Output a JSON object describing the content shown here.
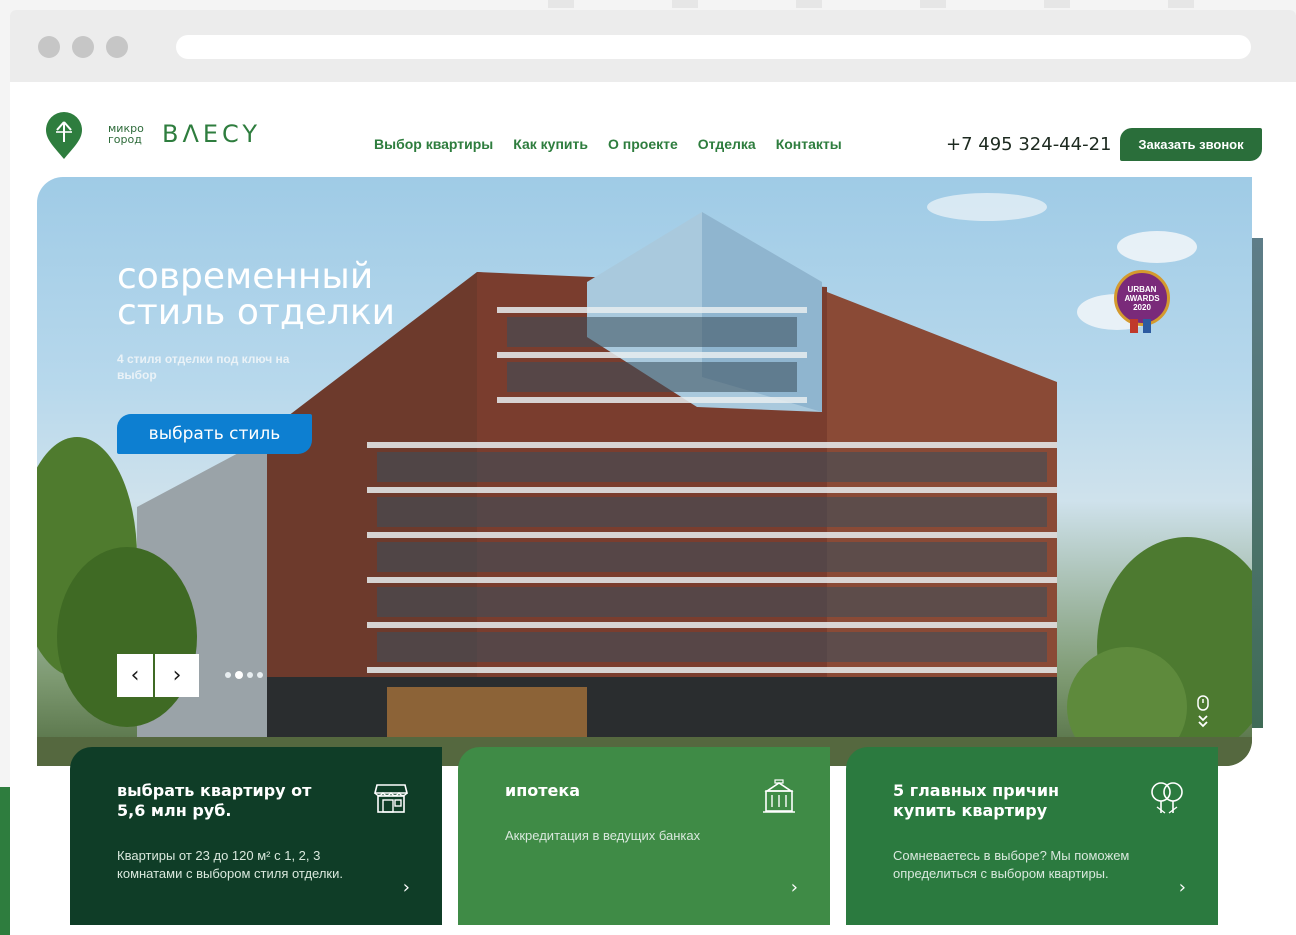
{
  "header": {
    "logo_small_line1": "микро",
    "logo_small_line2": "город",
    "logo_brand": "BΛECY",
    "nav": [
      "Выбор квартиры",
      "Как купить",
      "О проекте",
      "Отделка",
      "Контакты"
    ],
    "phone": "+7 495 324-44-21",
    "callback_label": "Заказать звонок"
  },
  "hero": {
    "title_line1": "современный",
    "title_line2": "стиль отделки",
    "subtitle": "4 стиля отделки под ключ на выбор",
    "cta_label": "выбрать стиль",
    "prev_label": "‹",
    "next_label": "›",
    "slide_count": 4,
    "active_slide": 2,
    "badge_line1": "URBAN",
    "badge_line2": "AWARDS",
    "badge_line3": "2020"
  },
  "cards": [
    {
      "title": "выбрать квартиру от 5,6 млн руб.",
      "description": "Квартиры от 23 до 120 м² с 1, 2, 3 комнатами с выбором стиля отделки.",
      "icon": "storefront-icon",
      "arrow": "›"
    },
    {
      "title": "ипотека",
      "description": "Аккредитация в ведущих банках",
      "icon": "bank-icon",
      "arrow": "›"
    },
    {
      "title": "5 главных причин купить квартиру",
      "description": "Сомневаетесь в выборе? Мы поможем определиться с выбором квартиры.",
      "icon": "trees-icon",
      "arrow": "›"
    }
  ],
  "colors": {
    "brand_green": "#2e7d3e",
    "dark_green": "#0f3d27",
    "cta_blue": "#0d7fd1"
  }
}
